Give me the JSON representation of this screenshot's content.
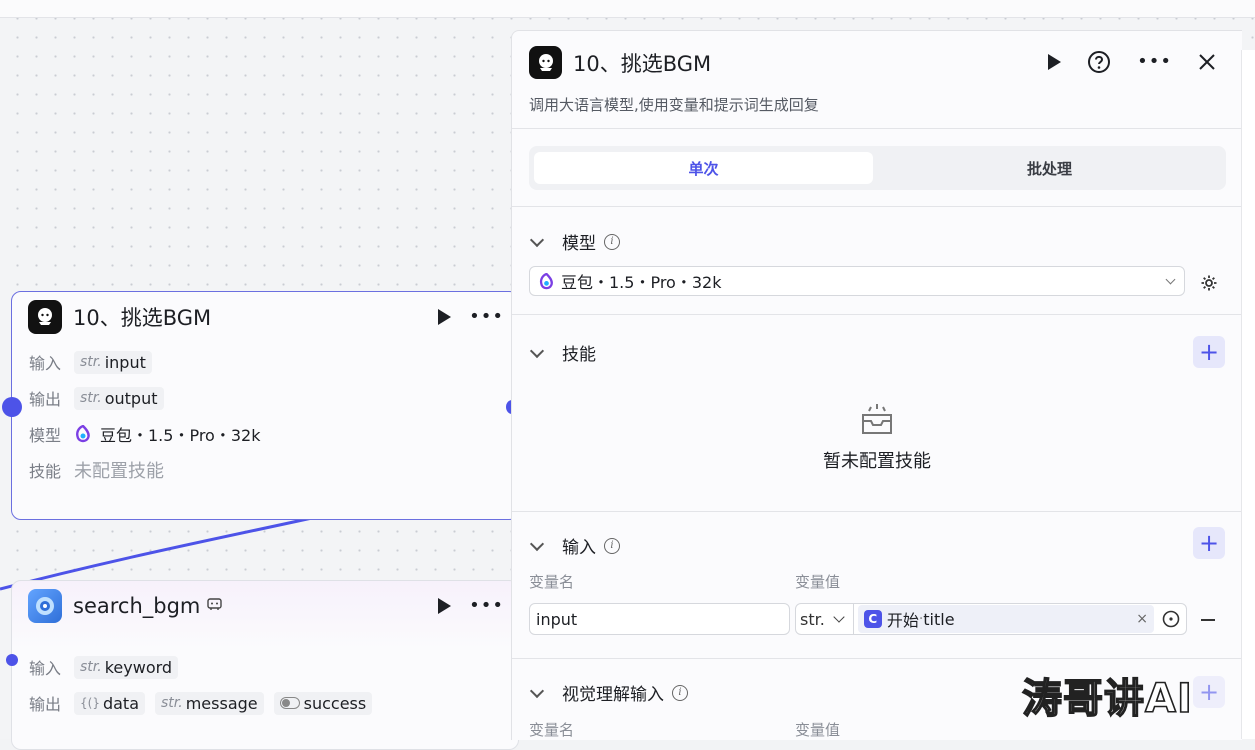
{
  "canvas": {
    "llm_node": {
      "title": "10、挑选BGM",
      "rows": [
        {
          "label": "输入",
          "type": "str.",
          "value": "input"
        },
        {
          "label": "输出",
          "type": "str.",
          "value": "output"
        }
      ],
      "model_label": "模型",
      "model_value": "豆包・1.5・Pro・32k",
      "skill_label": "技能",
      "skill_value": "未配置技能"
    },
    "plugin_node": {
      "title": "search_bgm",
      "input_label": "输入",
      "input_chip": {
        "type": "str.",
        "value": "keyword"
      },
      "output_label": "输出",
      "output_chips": [
        {
          "type": "{(}",
          "value": "data"
        },
        {
          "type": "str.",
          "value": "message"
        },
        {
          "type": "toggle",
          "value": "success"
        }
      ]
    },
    "edge_color": "#4d53e8"
  },
  "panel": {
    "title": "10、挑选BGM",
    "description": "调用大语言模型,使用变量和提示词生成回复",
    "tabs": [
      {
        "label": "单次",
        "active": true
      },
      {
        "label": "批处理",
        "active": false
      }
    ],
    "model_section": {
      "title": "模型",
      "selected": "豆包・1.5・Pro・32k"
    },
    "skill_section": {
      "title": "技能",
      "empty_text": "暂未配置技能"
    },
    "input_section": {
      "title": "输入",
      "col_name": "变量名",
      "col_value": "变量值",
      "rows": [
        {
          "name": "input",
          "type": "str.",
          "ref_node": "开始",
          "ref_sep": " · ",
          "ref_field": "title",
          "clear": "×"
        }
      ]
    },
    "vision_section": {
      "title": "视觉理解输入",
      "col_name": "变量名",
      "col_value": "变量值"
    }
  },
  "watermark": "涛哥讲AI",
  "colors": {
    "accent": "#4d53e8",
    "selected_border": "#6b6fe0"
  }
}
